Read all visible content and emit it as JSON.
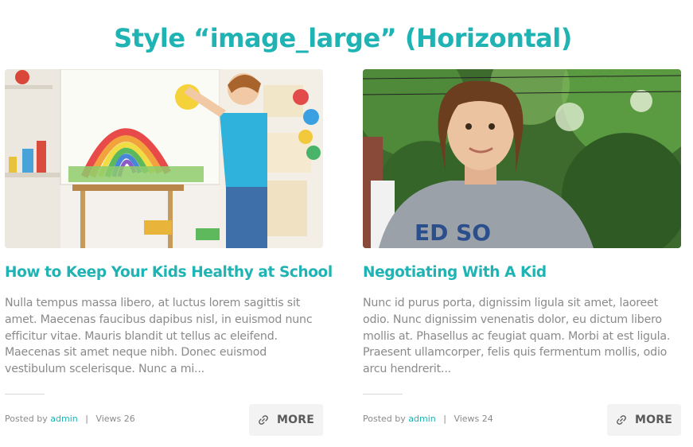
{
  "heading": "Style “image_large” (Horizontal)",
  "posts": [
    {
      "title": "How to Keep Your Kids Healthy at School",
      "excerpt": "Nulla tempus massa libero, at luctus lorem sagittis sit amet. Maecenas faucibus dapibus nisl, in euismod nunc efficitur vitae. Mauris blandit ut tellus ac eleifend. Maecenas sit amet neque nibh. Donec euismod vestibulum scelerisque. Nunc a mi...",
      "posted_by_label": "Posted by",
      "author": "admin",
      "separator": "|",
      "views_label": "Views 26",
      "more_label": "MORE",
      "image_icon": "kid-painting-rainbow-image"
    },
    {
      "title": "Negotiating With A Kid",
      "excerpt": "Nunc id purus porta, dignissim ligula sit amet, laoreet odio. Nunc dignissim venenatis dolor, eu dictum libero mollis at. Phasellus ac feugiat quam. Morbi at est ligula. Praesent ullamcorper, felis quis fermentum mollis, odio arcu hendrerit...",
      "posted_by_label": "Posted by",
      "author": "admin",
      "separator": "|",
      "views_label": "Views 24",
      "more_label": "MORE",
      "image_icon": "smiling-boy-portrait-image"
    }
  ],
  "colors": {
    "accent": "#1fb3b4",
    "text_muted": "#8a8a8a",
    "button_bg": "#f3f3f3",
    "button_text": "#5a5a5a"
  },
  "icons": {
    "more_button_icon": "link-icon"
  }
}
